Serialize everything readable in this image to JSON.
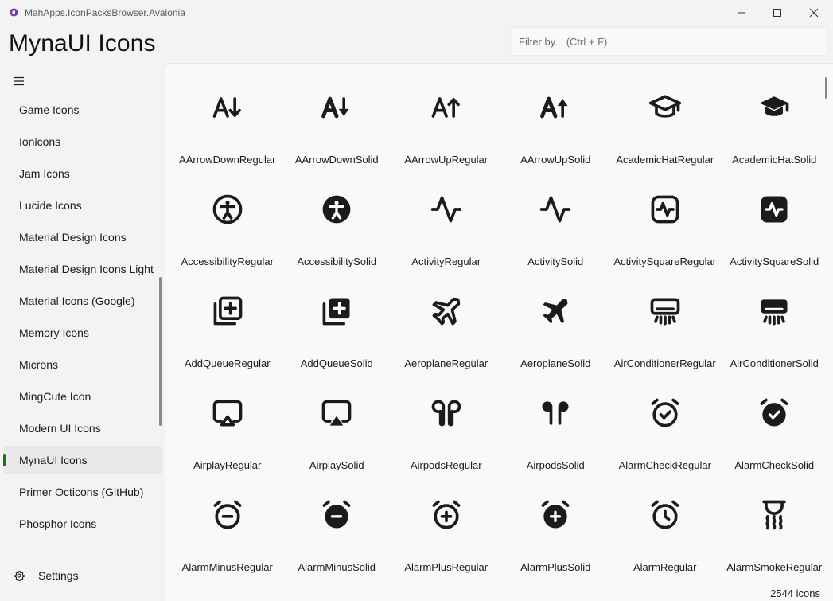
{
  "window": {
    "title": "MahApps.IconPacksBrowser.Avalonia",
    "logo_icon": "avalonia-logo-icon",
    "controls": {
      "minimize_icon": "minimize-icon",
      "maximize_icon": "maximize-icon",
      "close_icon": "close-icon"
    }
  },
  "header": {
    "title": "MynaUI Icons",
    "search": {
      "placeholder": "Filter by... (Ctrl + F)",
      "value": ""
    }
  },
  "sidebar": {
    "menu_icon": "hamburger-menu-icon",
    "items": [
      {
        "label": "Game Icons",
        "selected": false
      },
      {
        "label": "Ionicons",
        "selected": false
      },
      {
        "label": "Jam Icons",
        "selected": false
      },
      {
        "label": "Lucide Icons",
        "selected": false
      },
      {
        "label": "Material Design Icons",
        "selected": false
      },
      {
        "label": "Material Design Icons Light",
        "selected": false
      },
      {
        "label": "Material Icons (Google)",
        "selected": false
      },
      {
        "label": "Memory Icons",
        "selected": false
      },
      {
        "label": "Microns",
        "selected": false
      },
      {
        "label": "MingCute Icon",
        "selected": false
      },
      {
        "label": "Modern UI Icons",
        "selected": false
      },
      {
        "label": "MynaUI Icons",
        "selected": true
      },
      {
        "label": "Primer Octicons (GitHub)",
        "selected": false
      },
      {
        "label": "Phosphor Icons",
        "selected": false
      }
    ],
    "settings": {
      "label": "Settings",
      "icon": "gear-icon"
    },
    "accent_color": "#107c10"
  },
  "icons": [
    {
      "name": "AArrowDownRegular",
      "icon": "a-arrow-down-regular-icon"
    },
    {
      "name": "AArrowDownSolid",
      "icon": "a-arrow-down-solid-icon"
    },
    {
      "name": "AArrowUpRegular",
      "icon": "a-arrow-up-regular-icon"
    },
    {
      "name": "AArrowUpSolid",
      "icon": "a-arrow-up-solid-icon"
    },
    {
      "name": "AcademicHatRegular",
      "icon": "academic-hat-regular-icon"
    },
    {
      "name": "AcademicHatSolid",
      "icon": "academic-hat-solid-icon"
    },
    {
      "name": "AccessibilityRegular",
      "icon": "accessibility-regular-icon"
    },
    {
      "name": "AccessibilitySolid",
      "icon": "accessibility-solid-icon"
    },
    {
      "name": "ActivityRegular",
      "icon": "activity-regular-icon"
    },
    {
      "name": "ActivitySolid",
      "icon": "activity-solid-icon"
    },
    {
      "name": "ActivitySquareRegular",
      "icon": "activity-square-regular-icon"
    },
    {
      "name": "ActivitySquareSolid",
      "icon": "activity-square-solid-icon"
    },
    {
      "name": "AddQueueRegular",
      "icon": "add-queue-regular-icon"
    },
    {
      "name": "AddQueueSolid",
      "icon": "add-queue-solid-icon"
    },
    {
      "name": "AeroplaneRegular",
      "icon": "aeroplane-regular-icon"
    },
    {
      "name": "AeroplaneSolid",
      "icon": "aeroplane-solid-icon"
    },
    {
      "name": "AirConditionerRegular",
      "icon": "air-conditioner-regular-icon"
    },
    {
      "name": "AirConditionerSolid",
      "icon": "air-conditioner-solid-icon"
    },
    {
      "name": "AirplayRegular",
      "icon": "airplay-regular-icon"
    },
    {
      "name": "AirplaySolid",
      "icon": "airplay-solid-icon"
    },
    {
      "name": "AirpodsRegular",
      "icon": "airpods-regular-icon"
    },
    {
      "name": "AirpodsSolid",
      "icon": "airpods-solid-icon"
    },
    {
      "name": "AlarmCheckRegular",
      "icon": "alarm-check-regular-icon"
    },
    {
      "name": "AlarmCheckSolid",
      "icon": "alarm-check-solid-icon"
    },
    {
      "name": "AlarmMinusRegular",
      "icon": "alarm-minus-regular-icon"
    },
    {
      "name": "AlarmMinusSolid",
      "icon": "alarm-minus-solid-icon"
    },
    {
      "name": "AlarmPlusRegular",
      "icon": "alarm-plus-regular-icon"
    },
    {
      "name": "AlarmPlusSolid",
      "icon": "alarm-plus-solid-icon"
    },
    {
      "name": "AlarmRegular",
      "icon": "alarm-regular-icon"
    },
    {
      "name": "AlarmSmokeRegular",
      "icon": "alarm-smoke-regular-icon"
    }
  ],
  "status": {
    "count_text": "2544 icons"
  }
}
